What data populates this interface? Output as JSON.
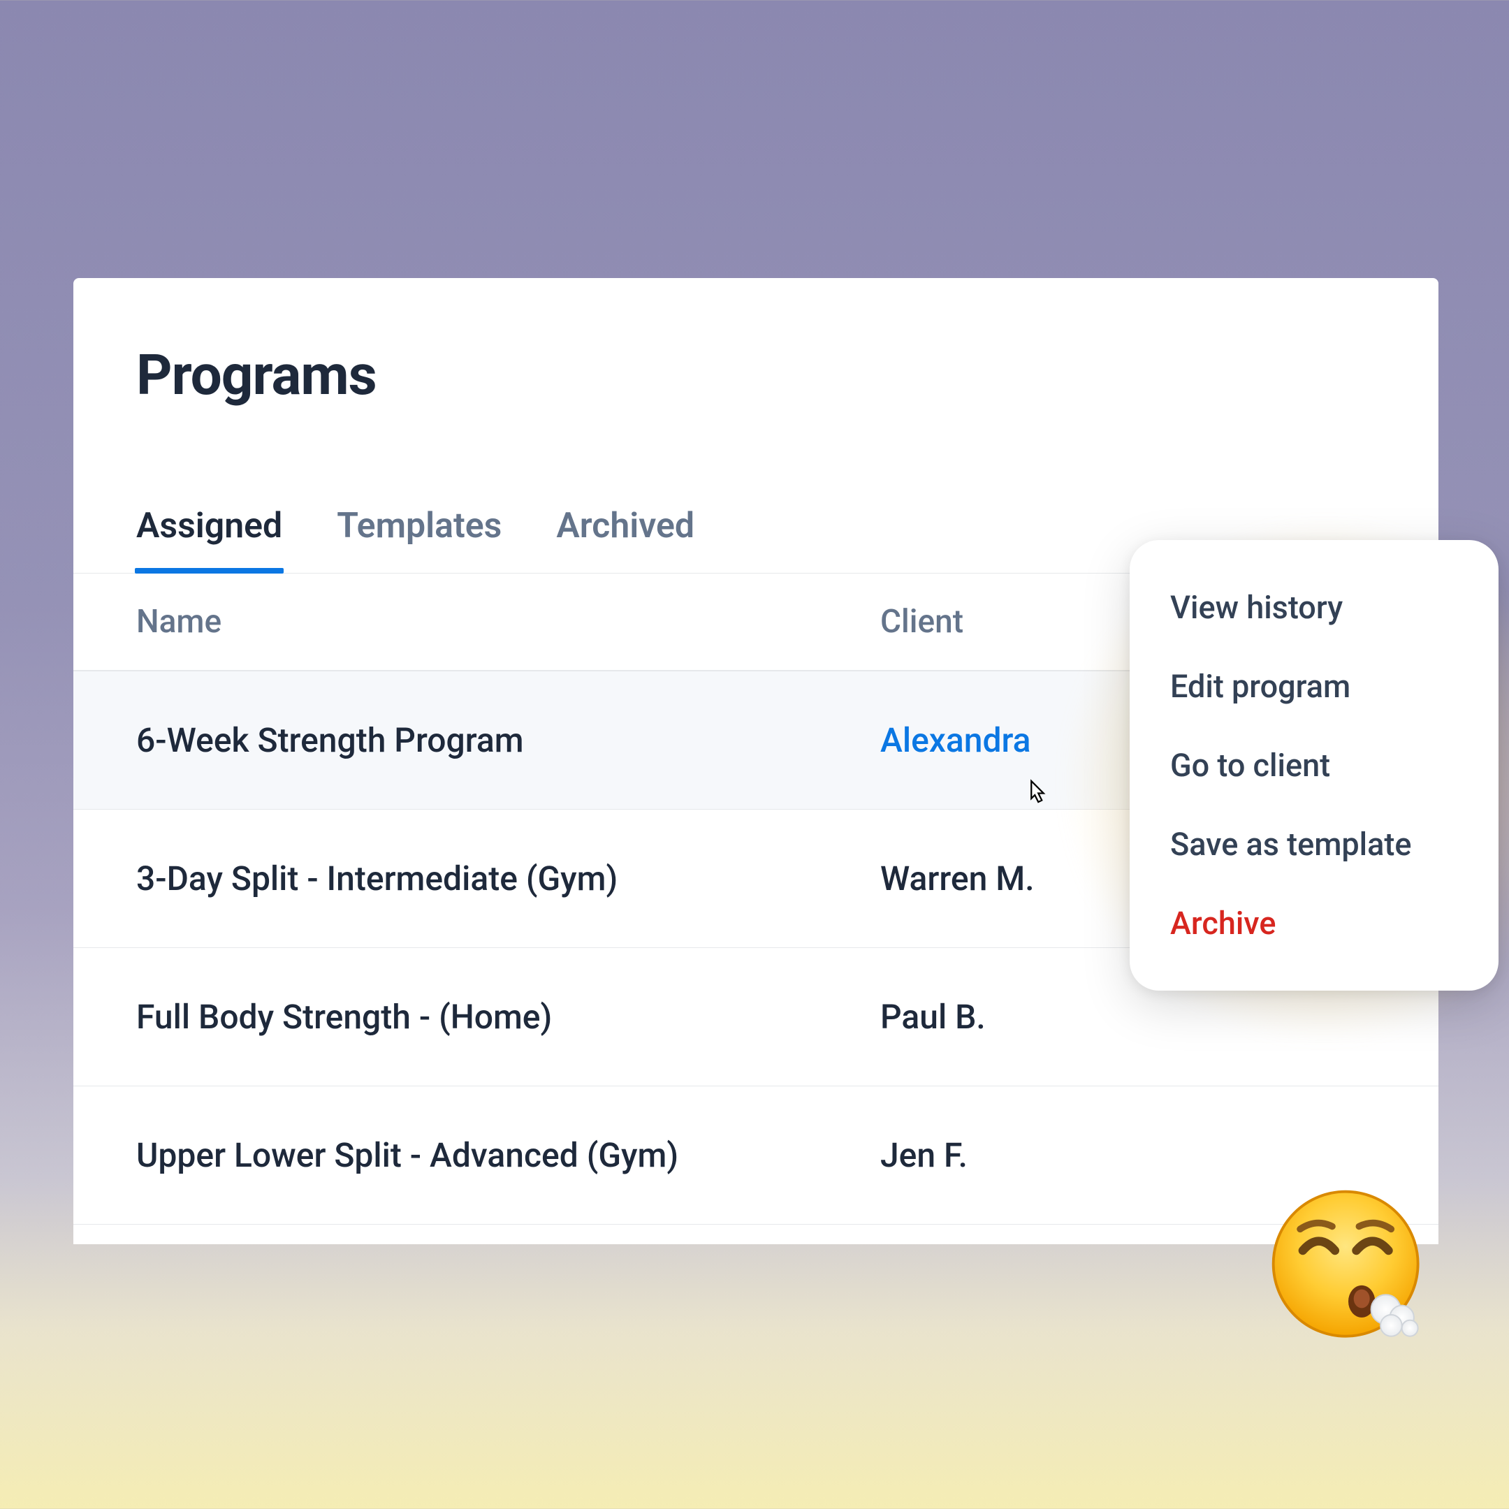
{
  "title": "Programs",
  "tabs": {
    "assigned": "Assigned",
    "templates": "Templates",
    "archived": "Archived"
  },
  "columns": {
    "name": "Name",
    "client": "Client"
  },
  "rows": [
    {
      "name": "6-Week Strength Program",
      "client": "Alexandra"
    },
    {
      "name": "3-Day Split - Intermediate (Gym)",
      "client": "Warren M."
    },
    {
      "name": "Full Body Strength - (Home)",
      "client": "Paul B."
    },
    {
      "name": "Upper Lower Split - Advanced (Gym)",
      "client": "Jen F."
    }
  ],
  "menu": {
    "view_history": "View history",
    "edit_program": "Edit program",
    "go_to_client": "Go to client",
    "save_as_template": "Save as template",
    "archive": "Archive"
  },
  "colors": {
    "accent": "#0b77e3",
    "danger": "#d7261f"
  },
  "emoji": "exhale-relief-face"
}
